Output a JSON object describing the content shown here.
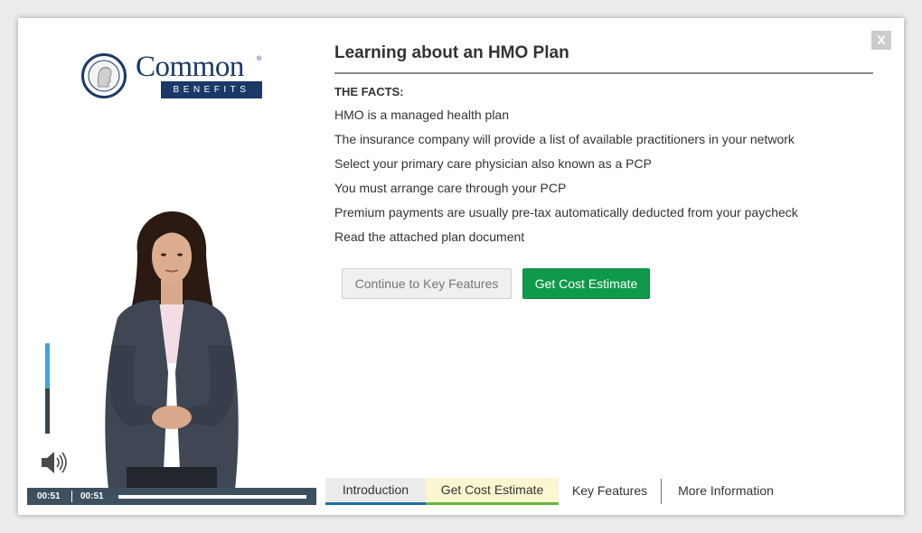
{
  "logo": {
    "word": "Common",
    "reg": "®",
    "band": "BENEFITS"
  },
  "modal": {
    "close_label": "X",
    "title": "Learning about an HMO Plan",
    "facts_heading": "THE FACTS:",
    "facts": [
      "HMO is a managed health plan",
      "The insurance company will provide a list of available practitioners in your network",
      "Select your primary care physician also known as a PCP",
      "You must arrange care through your PCP",
      "Premium payments are usually pre-tax automatically deducted from your paycheck",
      "Read the attached plan document"
    ],
    "buttons": {
      "continue_label": "Continue to Key Features",
      "estimate_label": "Get Cost Estimate"
    }
  },
  "player": {
    "current_time": "00:51",
    "total_time": "00:51",
    "volume_level": 0.5,
    "progress": 1.0
  },
  "tabs": [
    {
      "label": "Introduction"
    },
    {
      "label": "Get Cost Estimate"
    },
    {
      "label": "Key Features"
    },
    {
      "label": "More Information"
    }
  ],
  "colors": {
    "brand_navy": "#1b3968",
    "accent_green": "#0e9a4a",
    "player_bar": "#3d5060",
    "volume_blue": "#4a9fdc"
  },
  "icons": [
    "close-icon",
    "speaker-icon",
    "logo-seal-icon"
  ]
}
